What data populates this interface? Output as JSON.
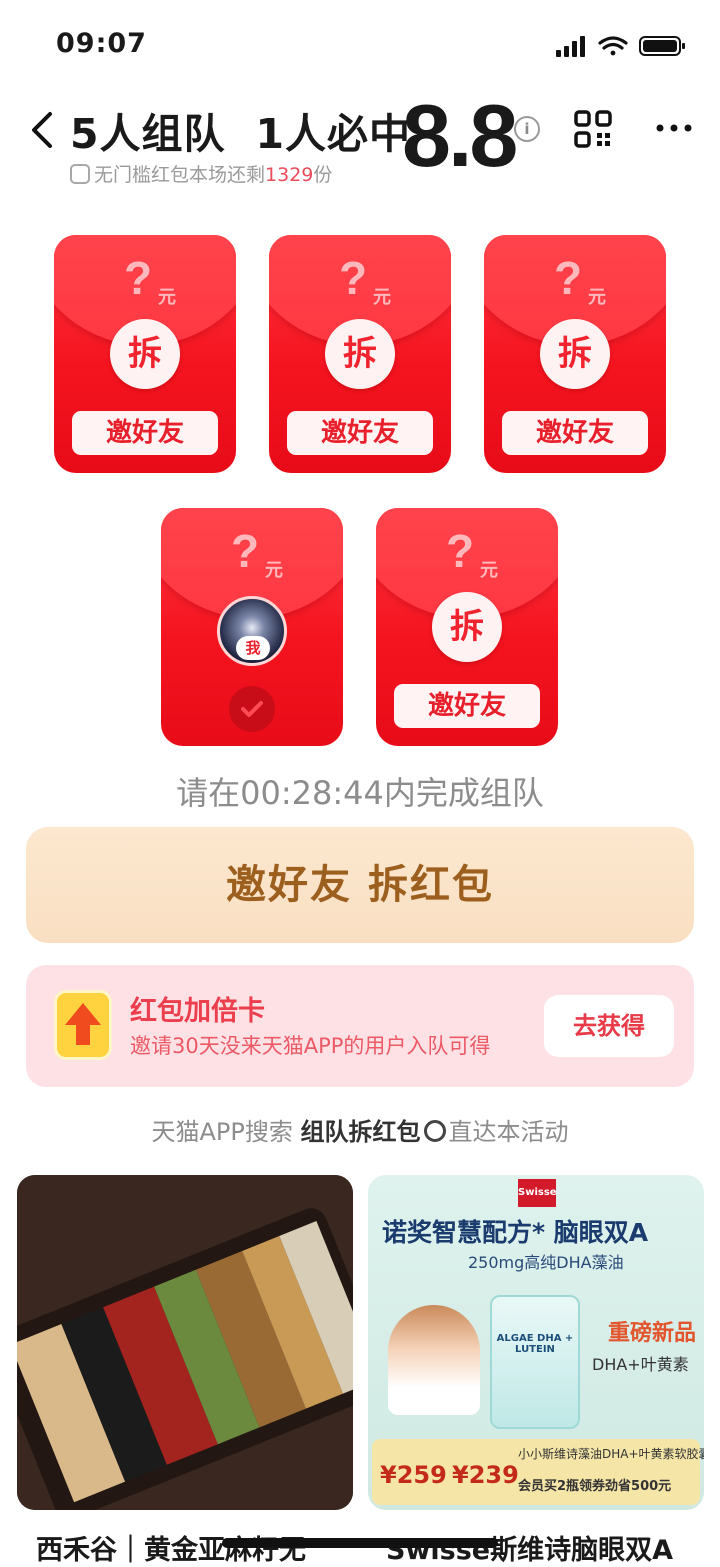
{
  "status_bar": {
    "time": "09:07"
  },
  "header": {
    "title_part1": "5人组队",
    "title_part2": "1人必中",
    "amount": "8.8",
    "info": "i",
    "subtitle_prefix": "无门槛红包本场还剩",
    "subtitle_count": "1329",
    "subtitle_suffix": "份"
  },
  "envelopes": [
    {
      "amount": "?",
      "unit": "元",
      "open": "拆",
      "invite": "邀好友"
    },
    {
      "amount": "?",
      "unit": "元",
      "open": "拆",
      "invite": "邀好友"
    },
    {
      "amount": "?",
      "unit": "元",
      "open": "拆",
      "invite": "邀好友"
    },
    {
      "amount": "?",
      "unit": "元",
      "me": "我",
      "joined": true
    },
    {
      "amount": "?",
      "unit": "元",
      "open": "拆",
      "invite": "邀好友"
    }
  ],
  "countdown": "请在00:28:44内完成组队",
  "cta": "邀好友 拆红包",
  "bonus_card": {
    "title": "红包加倍卡",
    "desc": "邀请30天没来天猫APP的用户入队可得",
    "button": "去获得"
  },
  "search_hint": {
    "prefix": "天猫APP搜索",
    "keyword": "组队拆红包",
    "suffix": "直达本活动"
  },
  "products": [
    {
      "name": "西禾谷｜黄金亚麻籽无"
    },
    {
      "name": "Swisse斯维诗脑眼双A",
      "brand": "Swisse",
      "headline": "诺奖智慧配方* 脑眼双A",
      "sub": "250mg高纯DHA藻油",
      "bottle_label": "ALGAE DHA + LUTEIN",
      "tag_new": "重磅新品",
      "tag_new_sub": "DHA+叶黄素",
      "price1": "¥259",
      "price2": "¥239",
      "note1": "小小斯维诗藻油DHA+叶黄素软胶囊30粒",
      "note2": "会员买2瓶领券劲省500元"
    }
  ],
  "colors": {
    "envelope_red": "#f4141f",
    "accent_pink": "#e94b5a",
    "cta_bg": "#fce8cf",
    "cta_text": "#9c5f1e",
    "card_bg": "#fde1e5"
  }
}
